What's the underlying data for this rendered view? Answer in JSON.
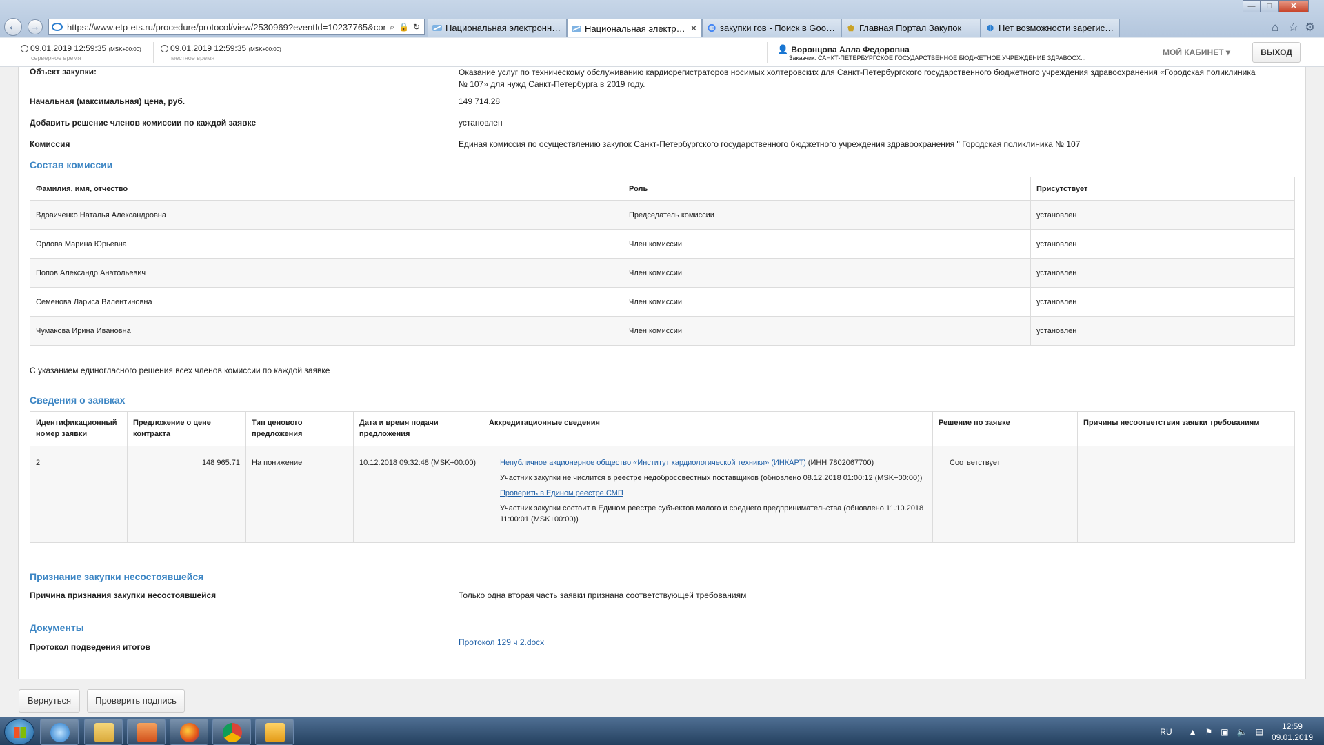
{
  "browser": {
    "url": "https://www.etp-ets.ru/procedure/protocol/view/2530969?eventId=10237765&contra",
    "back_glyph": "←",
    "forward_glyph": "→",
    "tabs": [
      {
        "label": "Национальная электронная ..."
      },
      {
        "label": "Национальная электронн..."
      },
      {
        "label": "закупки гов - Поиск в Google"
      },
      {
        "label": "Главная Портал Закупок"
      },
      {
        "label": "Нет возможности зарегистри..."
      }
    ],
    "close_tab_glyph": "✕",
    "window_buttons": {
      "minimize": "—",
      "maximize": "□",
      "close": "✕"
    }
  },
  "header": {
    "server_time": "09.01.2019 12:59:35",
    "server_tz": "(MSK+00:00)",
    "server_label": "серверное время",
    "local_time": "09.01.2019 12:59:35",
    "local_tz": "(MSK+00:00)",
    "local_label": "местное время",
    "user_name": "Воронцова Алла Федоровна",
    "user_org": "Заказчик: САНКТ-ПЕТЕРБУРГСКОЕ ГОСУДАРСТВЕННОЕ БЮДЖЕТНОЕ УЧРЕЖДЕНИЕ ЗДРАВООХ...",
    "my_cabinet": "МОЙ КАБИНЕТ",
    "logout": "ВЫХОД"
  },
  "details": {
    "object_label": "Объект закупки:",
    "object_value": "Оказание услуг по техническому обслуживанию кардиорегистраторов носимых холтеровских для Санкт-Петербургского государственного бюджетного учреждения здравоохранения «Городская поликлиника № 107» для нужд Санкт-Петербурга в 2019 году.",
    "price_label": "Начальная (максимальная) цена, руб.",
    "price_value": "149 714.28",
    "add_decision_label": "Добавить решение членов комиссии по каждой заявке",
    "add_decision_value": "установлен",
    "commission_label": "Комиссия",
    "commission_value": "Единая комиссия по осуществлению закупок Санкт-Петербургского государственного бюджетного учреждения здравоохранения \" Городская поликлиника № 107"
  },
  "commission": {
    "title": "Состав комиссии",
    "headers": [
      "Фамилия, имя, отчество",
      "Роль",
      "Присутствует"
    ],
    "rows": [
      [
        "Вдовиченко Наталья Александровна",
        "Председатель комиссии",
        "установлен"
      ],
      [
        "Орлова Марина Юрьевна",
        "Член комиссии",
        "установлен"
      ],
      [
        "Попов Александр Анатольевич",
        "Член комиссии",
        "установлен"
      ],
      [
        "Семенова Лариса Валентиновна",
        "Член комиссии",
        "установлен"
      ],
      [
        "Чумакова Ирина Ивановна",
        "Член комиссии",
        "установлен"
      ]
    ],
    "note": "С указанием единогласного решения всех членов комиссии по каждой заявке"
  },
  "bids": {
    "title": "Сведения о заявках",
    "headers": [
      "Идентификационный номер заявки",
      "Предложение о цене контракта",
      "Тип ценового предложения",
      "Дата и время подачи предложения",
      "Аккредитационные сведения",
      "Решение по заявке",
      "Причины несоответствия заявки требованиям"
    ],
    "row": {
      "id": "2",
      "price": "148 965.71",
      "type": "На понижение",
      "datetime": "10.12.2018 09:32:48 (MSK+00:00)",
      "org_link": "Непубличное акционерное общество «Институт кардиологической техники» (ИНКАРТ)",
      "org_inn": " (ИНН 7802067700)",
      "rnp_status": "Участник закупки не числится в реестре недобросовестных поставщиков (обновлено 08.12.2018 01:00:12 (MSK+00:00))",
      "smp_link": "Проверить в Едином реестре СМП",
      "smp_status": "Участник закупки состоит в Едином реестре субъектов малого и среднего предпринимательства (обновлено 11.10.2018 11:00:01 (MSK+00:00))",
      "decision": "Соответствует",
      "reasons": ""
    }
  },
  "failed": {
    "title": "Признание закупки несостоявшейся",
    "reason_label": "Причина признания закупки несостоявшейся",
    "reason_value": "Только одна вторая часть заявки признана соответствующей требованиям"
  },
  "documents": {
    "title": "Документы",
    "label": "Протокол подведения итогов",
    "link": "Протокол 129 ч 2.docx"
  },
  "buttons": {
    "back": "Вернуться",
    "verify": "Проверить подпись"
  },
  "taskbar": {
    "lang": "RU",
    "time": "12:59",
    "date": "09.01.2019"
  }
}
